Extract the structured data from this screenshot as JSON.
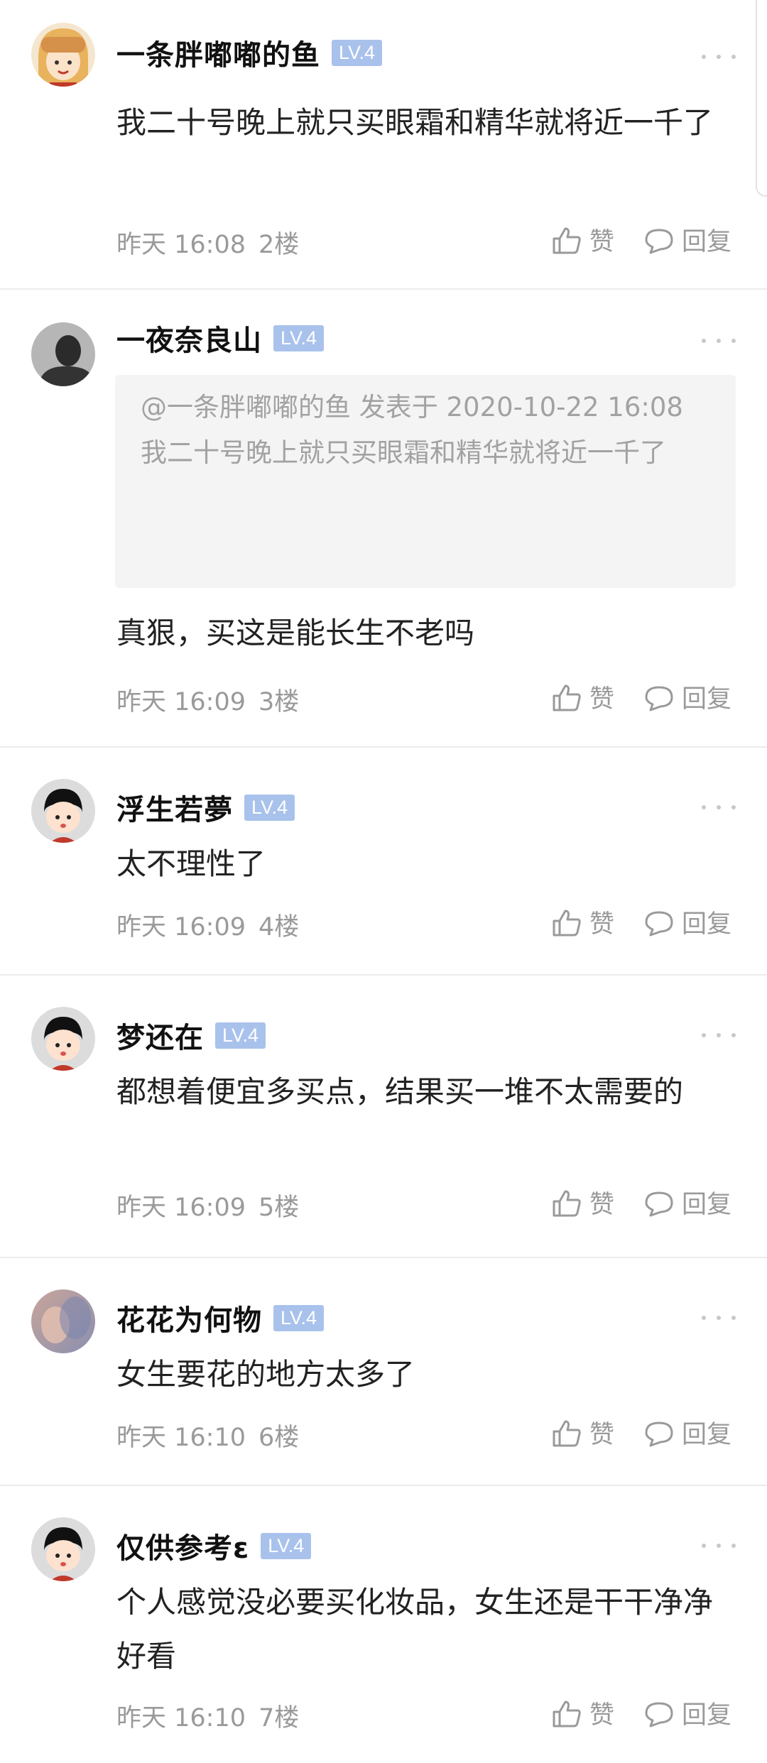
{
  "actions": {
    "like": "赞",
    "reply": "回复"
  },
  "comments": [
    {
      "name": "一条胖嘟嘟的鱼",
      "level": "LV.4",
      "text": "我二十号晚上就只买眼霜和精华就将近一千了",
      "time": "昨天 16:08",
      "floor": "2楼"
    },
    {
      "name": "一夜奈良山",
      "level": "LV.4",
      "quote": {
        "head": "@一条胖嘟嘟的鱼 发表于 2020-10-22 16:08",
        "body": "我二十号晚上就只买眼霜和精华就将近一千了"
      },
      "text": "真狠，买这是能长生不老吗",
      "time": "昨天 16:09",
      "floor": "3楼"
    },
    {
      "name": "浮生若夢",
      "level": "LV.4",
      "text": "太不理性了",
      "time": "昨天 16:09",
      "floor": "4楼"
    },
    {
      "name": "梦还在",
      "level": "LV.4",
      "text": "都想着便宜多买点，结果买一堆不太需要的",
      "time": "昨天 16:09",
      "floor": "5楼"
    },
    {
      "name": "花花为何物",
      "level": "LV.4",
      "text": "女生要花的地方太多了",
      "time": "昨天 16:10",
      "floor": "6楼"
    },
    {
      "name": "仅供参考ε",
      "level": "LV.4",
      "text": "个人感觉没必要买化妆品，女生还是干干净净好看",
      "time": "昨天 16:10",
      "floor": "7楼"
    }
  ]
}
